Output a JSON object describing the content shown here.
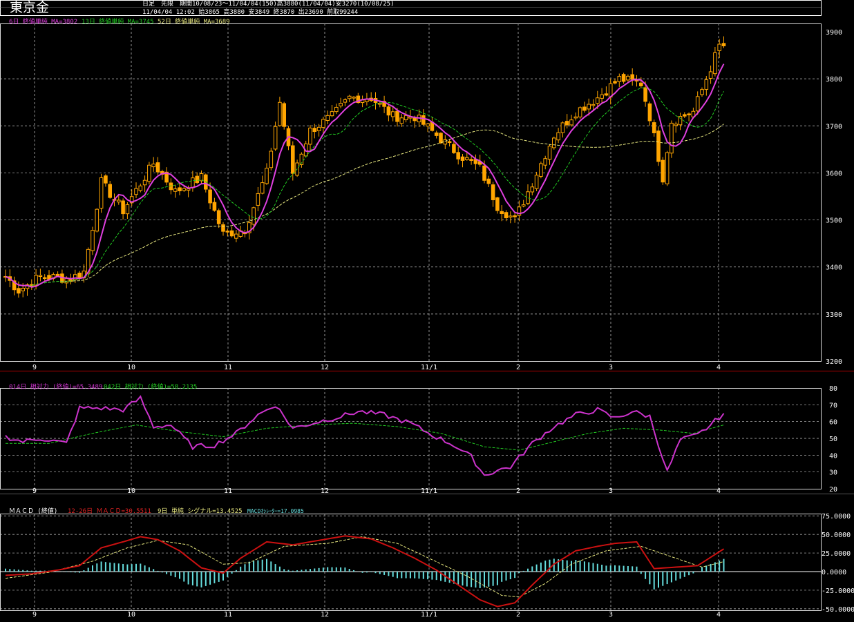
{
  "header": {
    "title": "東京金",
    "line1": "日足　先限　期間10/08/23〜11/04/04(150)高3880(11/04/04)安3270(10/08/25)",
    "line2": "11/04/04 12:02 始3865 高3880 安3849 終3870 出23690 前取99244"
  },
  "price_legend": {
    "ma6": "6日 終値単純 MA=3802",
    "ma13": "13日 終値単純 MA=3745",
    "ma52": "52日 終値単純 MA=3689"
  },
  "rsi_legend": {
    "rsi14": "014日 相対力 (終値)=65.3489",
    "rsi42": "042日 相対力 (終値)=58.2135"
  },
  "macd_legend": {
    "label": "ＭＡＣＤ (終値)",
    "macd": "12-26日 ＭＡＣＤ=30.5511",
    "signal": "9日 単純 シグナル=13.4525",
    "osc": "MACDｵｼﾚｰﾀｰ=17.0985"
  },
  "colors": {
    "candle": "#ffa500",
    "ma6": "#e040e0",
    "ma13": "#22cc22",
    "ma52": "#e8e880",
    "rsi14": "#cc33cc",
    "rsi42": "#22cc22",
    "macd": "#cc1111",
    "signal": "#e8e880",
    "hist": "#66dddd"
  },
  "chart_data": [
    {
      "type": "candlestick",
      "x_ticks": [
        "9",
        "10",
        "11",
        "12",
        "11/1",
        "2",
        "3",
        "4"
      ],
      "y_ticks": [
        3200,
        3300,
        3400,
        3500,
        3600,
        3700,
        3800,
        3900
      ],
      "ylim": [
        3200,
        3900
      ],
      "keypoints_close": [
        [
          0,
          3380
        ],
        [
          3,
          3350
        ],
        [
          8,
          3380
        ],
        [
          15,
          3375
        ],
        [
          18,
          3390
        ],
        [
          22,
          3580
        ],
        [
          27,
          3520
        ],
        [
          34,
          3620
        ],
        [
          39,
          3560
        ],
        [
          45,
          3590
        ],
        [
          50,
          3470
        ],
        [
          55,
          3480
        ],
        [
          60,
          3600
        ],
        [
          63,
          3750
        ],
        [
          66,
          3600
        ],
        [
          70,
          3690
        ],
        [
          75,
          3720
        ],
        [
          79,
          3760
        ],
        [
          84,
          3760
        ],
        [
          89,
          3720
        ],
        [
          94,
          3720
        ],
        [
          99,
          3680
        ],
        [
          104,
          3640
        ],
        [
          109,
          3610
        ],
        [
          113,
          3530
        ],
        [
          117,
          3500
        ],
        [
          121,
          3580
        ],
        [
          126,
          3680
        ],
        [
          131,
          3730
        ],
        [
          136,
          3760
        ],
        [
          141,
          3800
        ],
        [
          146,
          3790
        ],
        [
          148,
          3720
        ],
        [
          151,
          3590
        ],
        [
          153,
          3710
        ],
        [
          158,
          3730
        ],
        [
          161,
          3800
        ],
        [
          164,
          3870
        ]
      ],
      "ma6_last": 3802,
      "ma13_last": 3745,
      "ma52_last": 3689
    },
    {
      "type": "line",
      "title": "相対力指数",
      "y_ticks": [
        20,
        30,
        40,
        50,
        60,
        70,
        80
      ],
      "ylim": [
        20,
        80
      ],
      "rsi14_keypoints": [
        [
          0,
          51
        ],
        [
          4,
          48
        ],
        [
          8,
          50
        ],
        [
          14,
          47
        ],
        [
          17,
          68
        ],
        [
          22,
          68
        ],
        [
          27,
          67
        ],
        [
          31,
          74
        ],
        [
          34,
          57
        ],
        [
          38,
          58
        ],
        [
          43,
          45
        ],
        [
          48,
          46
        ],
        [
          53,
          53
        ],
        [
          58,
          64
        ],
        [
          62,
          70
        ],
        [
          66,
          56
        ],
        [
          72,
          60
        ],
        [
          77,
          63
        ],
        [
          81,
          66
        ],
        [
          87,
          64
        ],
        [
          93,
          59
        ],
        [
          98,
          52
        ],
        [
          103,
          46
        ],
        [
          107,
          39
        ],
        [
          110,
          28
        ],
        [
          113,
          31
        ],
        [
          116,
          33
        ],
        [
          121,
          47
        ],
        [
          126,
          57
        ],
        [
          131,
          64
        ],
        [
          136,
          67
        ],
        [
          140,
          62
        ],
        [
          144,
          66
        ],
        [
          148,
          63
        ],
        [
          152,
          30
        ],
        [
          155,
          49
        ],
        [
          159,
          52
        ],
        [
          162,
          58
        ],
        [
          165,
          65
        ]
      ],
      "rsi42_keypoints": [
        [
          0,
          47
        ],
        [
          10,
          47
        ],
        [
          20,
          53
        ],
        [
          30,
          58
        ],
        [
          40,
          54
        ],
        [
          50,
          51
        ],
        [
          60,
          56
        ],
        [
          70,
          58
        ],
        [
          80,
          59
        ],
        [
          90,
          57
        ],
        [
          100,
          53
        ],
        [
          110,
          45
        ],
        [
          118,
          43
        ],
        [
          126,
          48
        ],
        [
          134,
          53
        ],
        [
          142,
          56
        ],
        [
          150,
          55
        ],
        [
          158,
          53
        ],
        [
          165,
          58
        ]
      ],
      "rsi14_last": 65.3489,
      "rsi42_last": 58.2135
    },
    {
      "type": "line",
      "title": "MACD",
      "y_ticks": [
        -50,
        -25,
        0,
        25,
        50,
        75
      ],
      "y_tick_labels": [
        "-50.0000",
        "-25.0000",
        "0.0000",
        "25.0000",
        "50.0000",
        "75.0000"
      ],
      "ylim": [
        -52,
        78
      ],
      "macd_keypoints": [
        [
          0,
          -5
        ],
        [
          6,
          -3
        ],
        [
          12,
          2
        ],
        [
          17,
          8
        ],
        [
          22,
          32
        ],
        [
          27,
          40
        ],
        [
          31,
          47
        ],
        [
          35,
          43
        ],
        [
          40,
          28
        ],
        [
          45,
          5
        ],
        [
          50,
          -2
        ],
        [
          54,
          18
        ],
        [
          60,
          40
        ],
        [
          66,
          36
        ],
        [
          72,
          42
        ],
        [
          78,
          48
        ],
        [
          84,
          44
        ],
        [
          89,
          32
        ],
        [
          94,
          18
        ],
        [
          99,
          2
        ],
        [
          104,
          -18
        ],
        [
          109,
          -38
        ],
        [
          113,
          -47
        ],
        [
          117,
          -42
        ],
        [
          121,
          -18
        ],
        [
          126,
          10
        ],
        [
          131,
          28
        ],
        [
          136,
          34
        ],
        [
          140,
          38
        ],
        [
          145,
          40
        ],
        [
          149,
          4
        ],
        [
          154,
          6
        ],
        [
          159,
          8
        ],
        [
          165,
          30.5511
        ]
      ],
      "signal_keypoints": [
        [
          0,
          -9
        ],
        [
          10,
          -1
        ],
        [
          20,
          14
        ],
        [
          28,
          32
        ],
        [
          35,
          42
        ],
        [
          42,
          36
        ],
        [
          50,
          10
        ],
        [
          56,
          12
        ],
        [
          64,
          34
        ],
        [
          74,
          38
        ],
        [
          82,
          47
        ],
        [
          90,
          38
        ],
        [
          98,
          16
        ],
        [
          106,
          -6
        ],
        [
          114,
          -32
        ],
        [
          118,
          -34
        ],
        [
          124,
          -16
        ],
        [
          130,
          10
        ],
        [
          138,
          28
        ],
        [
          146,
          34
        ],
        [
          154,
          18
        ],
        [
          160,
          6
        ],
        [
          165,
          13.4525
        ]
      ],
      "macd_last": 30.5511,
      "signal_last": 13.4525,
      "osc_last": 17.0985
    }
  ]
}
